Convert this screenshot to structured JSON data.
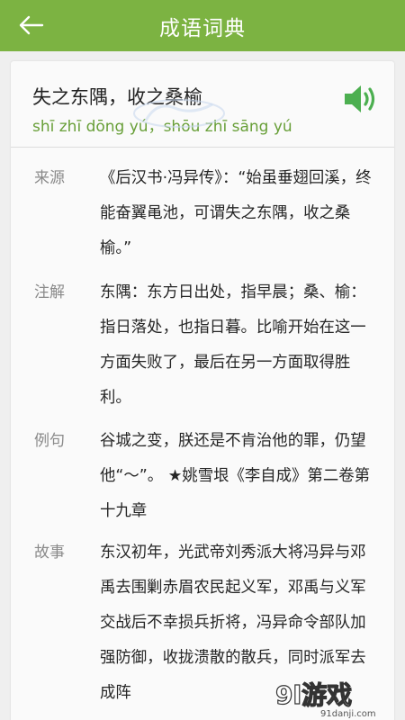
{
  "header": {
    "title": "成语词典",
    "back_icon": "back-arrow-icon"
  },
  "idiom": {
    "text": "失之东隅，收之桑榆",
    "pinyin": "shī zhī dōng yú，shōu zhī sāng yú",
    "speaker_icon": "speaker-icon"
  },
  "sections": [
    {
      "label": "来源",
      "content": "《后汉书·冯异传》：“始虽垂翅回溪，终能奋翼黾池，可谓失之东隅，收之桑榆。”"
    },
    {
      "label": "注解",
      "content": "东隅：东方日出处，指早晨；桑、榆：指日落处，也指日暮。比喻开始在这一方面失败了，最后在另一方面取得胜利。"
    },
    {
      "label": "例句",
      "content": "谷城之变，朕还是不肯治他的罪，仍望他“～”。 ★姚雪垠《李自成》第二卷第十九章"
    },
    {
      "label": "故事",
      "content": "东汉初年，光武帝刘秀派大将冯异与邓禹去围剿赤眉农民起义军，邓禹与义军交战后不幸损兵折将，冯异命令部队加强防御，收拢溃散的散兵，同时派军去成阵"
    }
  ],
  "watermark": {
    "logo_text": "9l游戏",
    "site": "91danji.com"
  },
  "colors": {
    "header_green": "#7cb342",
    "pinyin_green": "#689f38",
    "label_gray": "#8a8a8a"
  }
}
